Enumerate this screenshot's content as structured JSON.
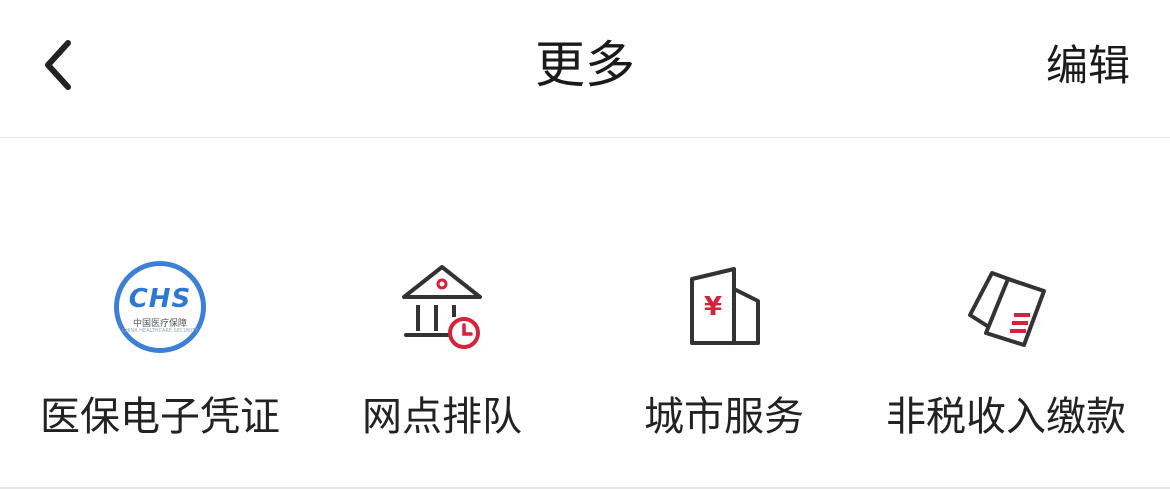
{
  "header": {
    "title": "更多",
    "edit_label": "编辑",
    "back_icon": "chevron-left-icon"
  },
  "services": [
    {
      "label": "医保电子凭证",
      "icon": "chs-medical-insurance-icon",
      "logo_text": "CHS",
      "logo_subtext": "中国医疗保障",
      "logo_subtext_small": "CHINA HEALTHCARE SECURITY"
    },
    {
      "label": "网点排队",
      "icon": "bank-branch-queue-icon"
    },
    {
      "label": "城市服务",
      "icon": "city-building-yuan-icon"
    },
    {
      "label": "非税收入缴款",
      "icon": "tax-cards-icon"
    }
  ],
  "colors": {
    "accent": "#d6223a",
    "icon_stroke": "#333333",
    "chs_blue": "#3b7fd6"
  }
}
